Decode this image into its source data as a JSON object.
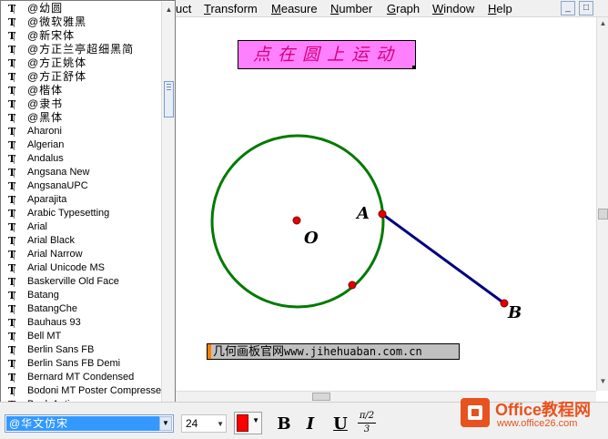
{
  "menubar": {
    "items": [
      {
        "pre": "",
        "acc": "",
        "rest": "uct"
      },
      {
        "pre": "",
        "acc": "T",
        "rest": "ransform"
      },
      {
        "pre": "",
        "acc": "M",
        "rest": "easure"
      },
      {
        "pre": "",
        "acc": "N",
        "rest": "umber"
      },
      {
        "pre": "",
        "acc": "G",
        "rest": "raph"
      },
      {
        "pre": "",
        "acc": "W",
        "rest": "indow"
      },
      {
        "pre": "",
        "acc": "H",
        "rest": "elp"
      }
    ],
    "window_buttons": [
      "_",
      "□"
    ]
  },
  "font_list": {
    "items": [
      "@幼圆",
      "@微软雅黑",
      "@新宋体",
      "@方正兰亭超细黑简",
      "@方正姚体",
      "@方正舒体",
      "@楷体",
      "@隶书",
      "@黑体",
      "Aharoni",
      "Algerian",
      "Andalus",
      "Angsana New",
      "AngsanaUPC",
      "Aparajita",
      "Arabic Typesetting",
      "Arial",
      "Arial Black",
      "Arial Narrow",
      "Arial Unicode MS",
      "Baskerville Old Face",
      "Batang",
      "BatangChe",
      "Bauhaus 93",
      "Bell MT",
      "Berlin Sans FB",
      "Berlin Sans FB Demi",
      "Bernard MT Condensed",
      "Bodoni MT Poster Compressed",
      "Book Antiqua"
    ],
    "icon_glyph": "T"
  },
  "canvas": {
    "title_text": "点在圆上运动",
    "url_label": "几何画板官网",
    "url_text": "www.jihehuaban.com.cn",
    "points": {
      "O": "O",
      "A": "A",
      "B": "B"
    },
    "colors": {
      "circle": "#007a00",
      "segment": "#000080",
      "point": "#e00000"
    }
  },
  "toolbar": {
    "font_value": "@华文仿宋",
    "size_value": "24",
    "color": "#ff0000",
    "bold": "B",
    "italic": "I",
    "underline": "U",
    "frac_top": "π/2",
    "frac_bottom": "3"
  },
  "watermark": {
    "name": "Office教程网",
    "url": "www.office26.com"
  }
}
